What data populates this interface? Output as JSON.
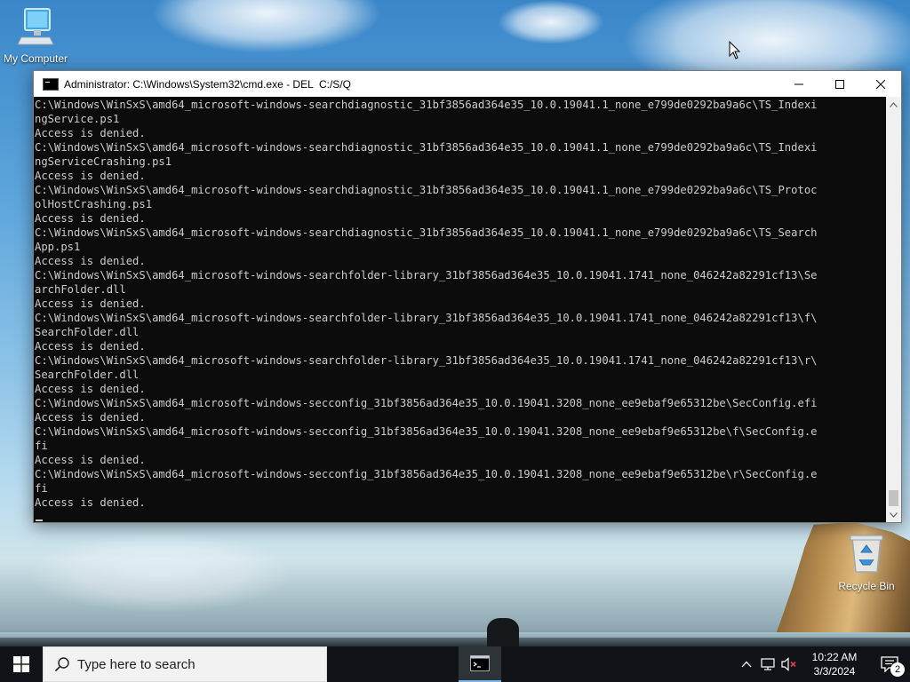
{
  "desktop": {
    "icons": [
      {
        "label": "My Computer",
        "icon": "computer-icon"
      },
      {
        "label": "Recycle Bin",
        "icon": "recycle-bin-icon"
      }
    ]
  },
  "window": {
    "title": "Administrator: C:\\Windows\\System32\\cmd.exe - DEL  C:/S/Q",
    "minimize": "─",
    "maximize": "☐",
    "close": "✕"
  },
  "console": {
    "lines": [
      "C:\\Windows\\WinSxS\\amd64_microsoft-windows-searchdiagnostic_31bf3856ad364e35_10.0.19041.1_none_e799de0292ba9a6c\\TS_Indexi",
      "ngService.ps1",
      "Access is denied.",
      "C:\\Windows\\WinSxS\\amd64_microsoft-windows-searchdiagnostic_31bf3856ad364e35_10.0.19041.1_none_e799de0292ba9a6c\\TS_Indexi",
      "ngServiceCrashing.ps1",
      "Access is denied.",
      "C:\\Windows\\WinSxS\\amd64_microsoft-windows-searchdiagnostic_31bf3856ad364e35_10.0.19041.1_none_e799de0292ba9a6c\\TS_Protoc",
      "olHostCrashing.ps1",
      "Access is denied.",
      "C:\\Windows\\WinSxS\\amd64_microsoft-windows-searchdiagnostic_31bf3856ad364e35_10.0.19041.1_none_e799de0292ba9a6c\\TS_Search",
      "App.ps1",
      "Access is denied.",
      "C:\\Windows\\WinSxS\\amd64_microsoft-windows-searchfolder-library_31bf3856ad364e35_10.0.19041.1741_none_046242a82291cf13\\Se",
      "archFolder.dll",
      "Access is denied.",
      "C:\\Windows\\WinSxS\\amd64_microsoft-windows-searchfolder-library_31bf3856ad364e35_10.0.19041.1741_none_046242a82291cf13\\f\\",
      "SearchFolder.dll",
      "Access is denied.",
      "C:\\Windows\\WinSxS\\amd64_microsoft-windows-searchfolder-library_31bf3856ad364e35_10.0.19041.1741_none_046242a82291cf13\\r\\",
      "SearchFolder.dll",
      "Access is denied.",
      "C:\\Windows\\WinSxS\\amd64_microsoft-windows-secconfig_31bf3856ad364e35_10.0.19041.3208_none_ee9ebaf9e65312be\\SecConfig.efi",
      "Access is denied.",
      "C:\\Windows\\WinSxS\\amd64_microsoft-windows-secconfig_31bf3856ad364e35_10.0.19041.3208_none_ee9ebaf9e65312be\\f\\SecConfig.e",
      "fi",
      "Access is denied.",
      "C:\\Windows\\WinSxS\\amd64_microsoft-windows-secconfig_31bf3856ad364e35_10.0.19041.3208_none_ee9ebaf9e65312be\\r\\SecConfig.e",
      "fi",
      "Access is denied."
    ]
  },
  "taskbar": {
    "search_placeholder": "Type here to search",
    "time": "10:22 AM",
    "date": "3/3/2024",
    "notification_count": "2"
  },
  "colors": {
    "console_bg": "#0c0c0c",
    "console_fg": "#cccccc",
    "taskbar_bg": "#101418",
    "accent": "#7cb7e8"
  }
}
